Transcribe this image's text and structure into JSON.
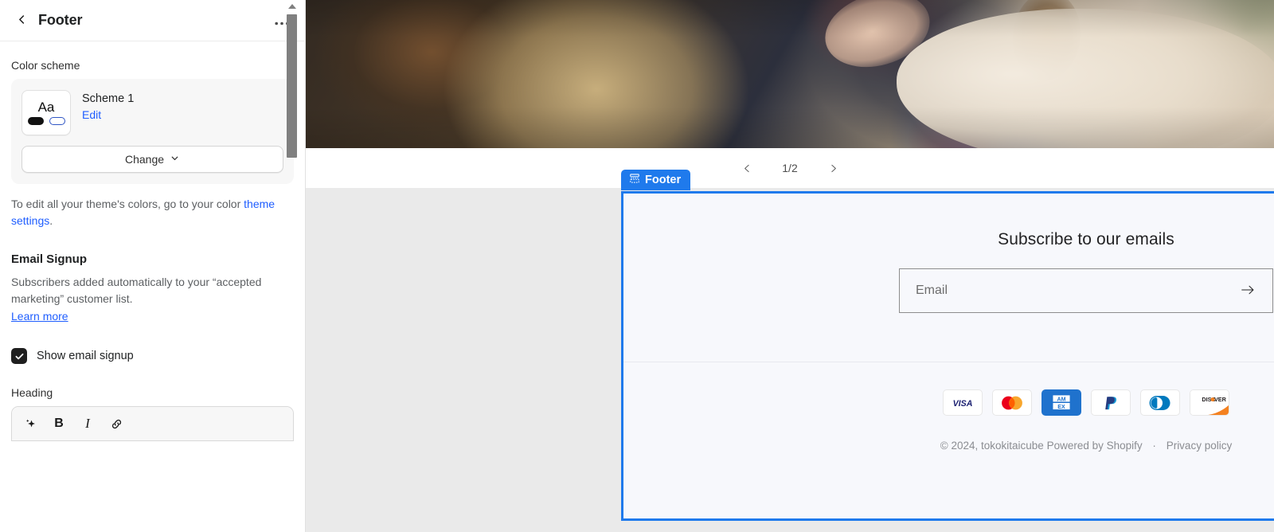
{
  "sidebar": {
    "back_icon": "chevron-left-icon",
    "title": "Footer",
    "more_icon": "ellipsis-icon",
    "color_scheme": {
      "label": "Color scheme",
      "swatch_text": "Aa",
      "scheme_name": "Scheme 1",
      "edit_label": "Edit",
      "change_label": "Change",
      "chevron_icon": "chevron-down-icon"
    },
    "help": {
      "text_before": "To edit all your theme's colors, go to your color ",
      "link_text": "theme settings",
      "text_after": "."
    },
    "email_signup": {
      "heading": "Email Signup",
      "description": "Subscribers added automatically to your “accepted marketing” customer list.",
      "learn_more": "Learn more",
      "checkbox_label": "Show email signup",
      "checkbox_checked": true
    },
    "heading_field": {
      "label": "Heading",
      "toolbar": [
        {
          "name": "ai-sparkle-icon",
          "glyph": "✦"
        },
        {
          "name": "bold-icon",
          "glyph": "B"
        },
        {
          "name": "italic-icon",
          "glyph": "I"
        },
        {
          "name": "link-icon",
          "glyph": "🔗"
        }
      ]
    }
  },
  "preview": {
    "hero_alt": "blurred photo of clothing rack with hands browsing garments",
    "pager": {
      "prev_icon": "chevron-left-icon",
      "prev_glyph": "‹",
      "count": "1/2",
      "next_icon": "chevron-right-icon",
      "next_glyph": "›"
    },
    "section_badge": {
      "icon": "footer-section-icon",
      "label": "Footer"
    },
    "footer": {
      "subscribe_title": "Subscribe to our emails",
      "email_placeholder": "Email",
      "email_value": "",
      "submit_icon": "arrow-right-icon",
      "payment_methods": [
        {
          "name": "visa",
          "label": "VISA"
        },
        {
          "name": "mastercard",
          "label": "Mastercard"
        },
        {
          "name": "amex",
          "label": "AM EX"
        },
        {
          "name": "paypal",
          "label": "PayPal"
        },
        {
          "name": "diners-club",
          "label": "Diners Club"
        },
        {
          "name": "discover",
          "label": "DISCOVER"
        }
      ],
      "copyright": "© 2024, tokokitaicube",
      "powered_by": "Powered by Shopify",
      "separator": "·",
      "privacy_policy": "Privacy policy"
    }
  },
  "colors": {
    "accent_blue": "#1f7aec",
    "link_blue": "#1f5eff",
    "footer_bg": "#f7f8fc",
    "sidebar_bg": "#ffffff"
  }
}
